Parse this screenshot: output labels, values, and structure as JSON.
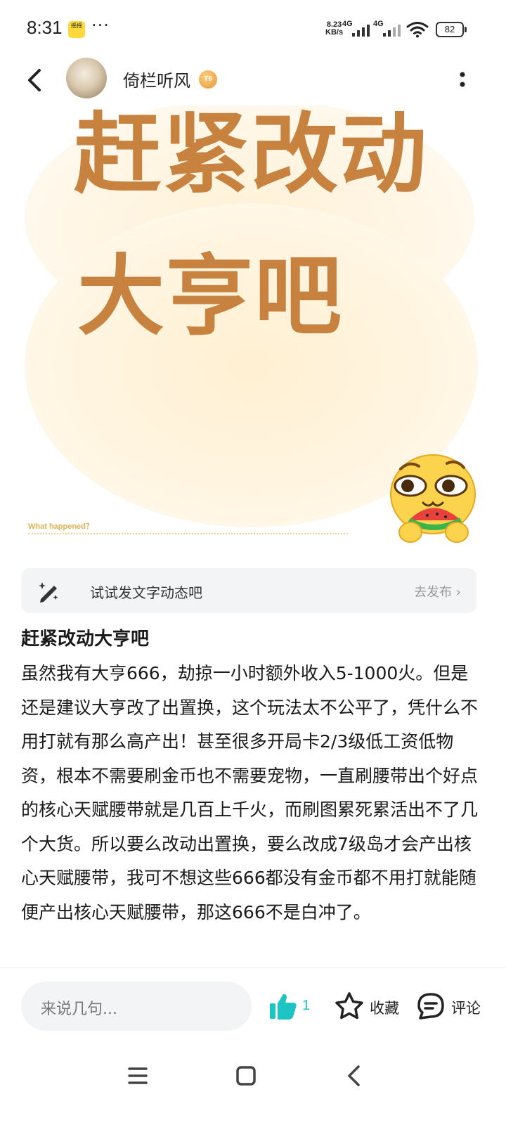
{
  "status_bar": {
    "time": "8:31",
    "app_badge": "摇摇",
    "more_dots": "···",
    "net_speed_value": "8.23",
    "net_speed_unit": "KB/s",
    "sim1_label": "4G",
    "sim2_label": "4G",
    "battery": "82"
  },
  "header": {
    "username": "倚栏听风",
    "level_badge": "T5"
  },
  "hero": {
    "line1": "赶紧改动",
    "line2": "大亨吧",
    "caption": "What happened？"
  },
  "prompt": {
    "text": "试试发文字动态吧",
    "action": "去发布"
  },
  "post": {
    "title": "赶紧改动大亨吧",
    "body": "虽然我有大亨666，劫掠一小时额外收入5-1000火。但是还是建议大亨改了出置换，这个玩法太不公平了，凭什么不用打就有那么高产出！甚至很多开局卡2/3级低工资低物资，根本不需要刷金币也不需要宠物，一直刷腰带出个好点的核心天赋腰带就是几百上千火，而刷图累死累活出不了几个大货。所以要么改动出置换，要么改成7级岛才会产出核心天赋腰带，我可不想这些666都没有金币都不用打就能随便产出核心天赋腰带，那这666不是白冲了。"
  },
  "bottom_bar": {
    "comment_placeholder": "来说几句...",
    "like_count": "1",
    "favorite_label": "收藏",
    "comment_label": "评论"
  },
  "colors": {
    "hero_text": "#c8823f",
    "like_accent": "#1cc4c4",
    "caption": "#e0b24f"
  },
  "icons": {
    "back": "chevron-left-icon",
    "more": "vertical-dots-icon",
    "prompt": "magic-pen-icon",
    "like": "thumbs-up-icon",
    "favorite": "star-icon",
    "comment": "chat-bubble-icon",
    "nav_menu": "menu-icon",
    "nav_home": "square-home-icon",
    "nav_back": "back-triangle-icon"
  }
}
